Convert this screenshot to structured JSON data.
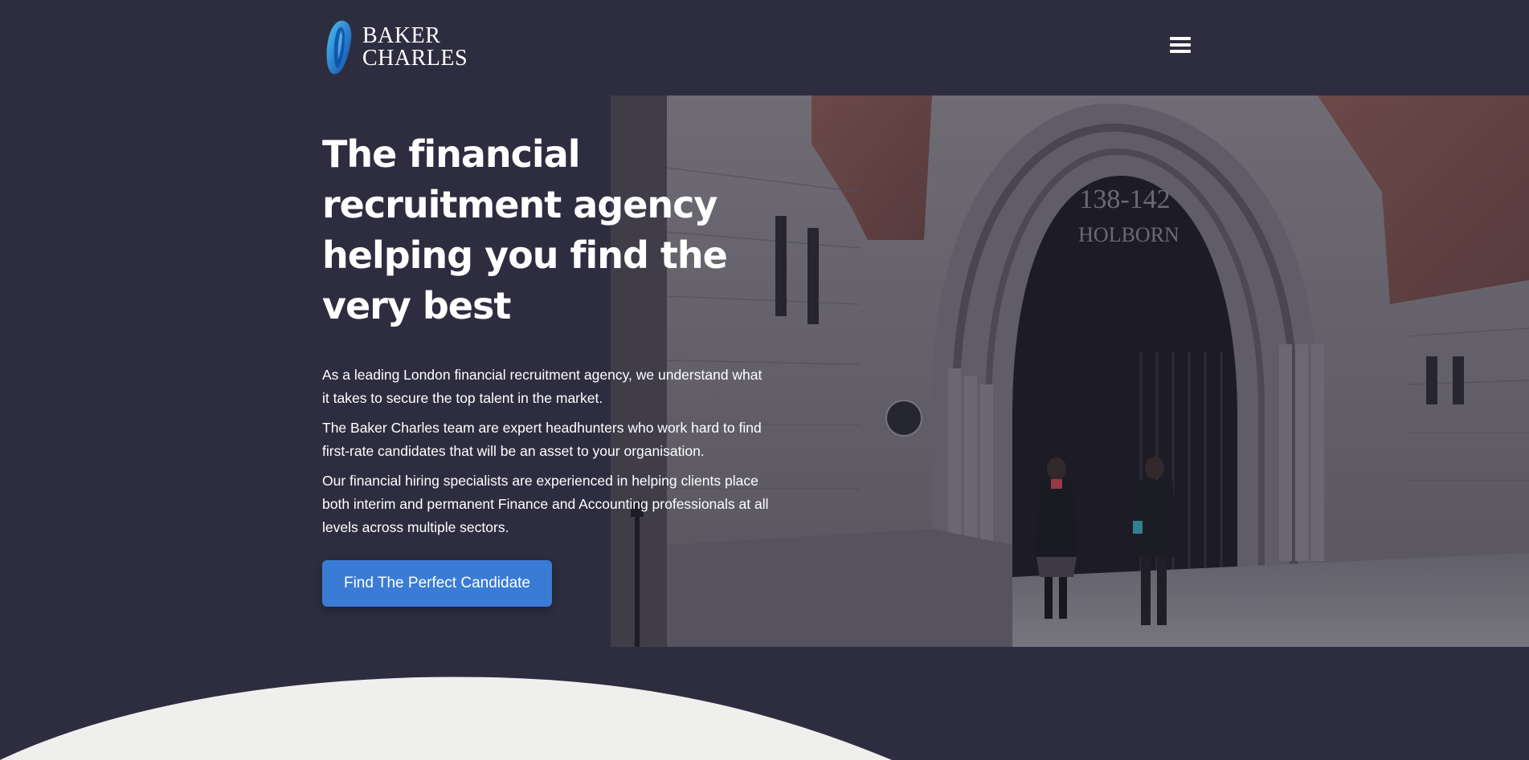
{
  "brand": {
    "line1": "BAKER",
    "line2": "CHARLES",
    "accent_color": "#1ea7e8"
  },
  "header": {
    "menu_icon": "hamburger-menu-icon"
  },
  "hero": {
    "title": "The financial recruitment agency helping you find the very best",
    "paragraphs": [
      "As a leading London financial recruitment agency, we understand what it takes to secure the top talent in the market.",
      "The Baker Charles team are expert headhunters who work hard to find first-rate candidates that will be an asset to your organisation.",
      "Our financial hiring specialists are experienced in helping clients place both interim and permanent Finance and Accounting professionals at all levels across multiple sectors."
    ],
    "cta_label": "Find The Perfect Candidate",
    "cta_color": "#3a7bd5",
    "photo": {
      "inscription_line1": "138-142",
      "inscription_line2": "HOLBORN"
    }
  },
  "colors": {
    "background": "#2e2d40",
    "wave": "#efefed"
  }
}
